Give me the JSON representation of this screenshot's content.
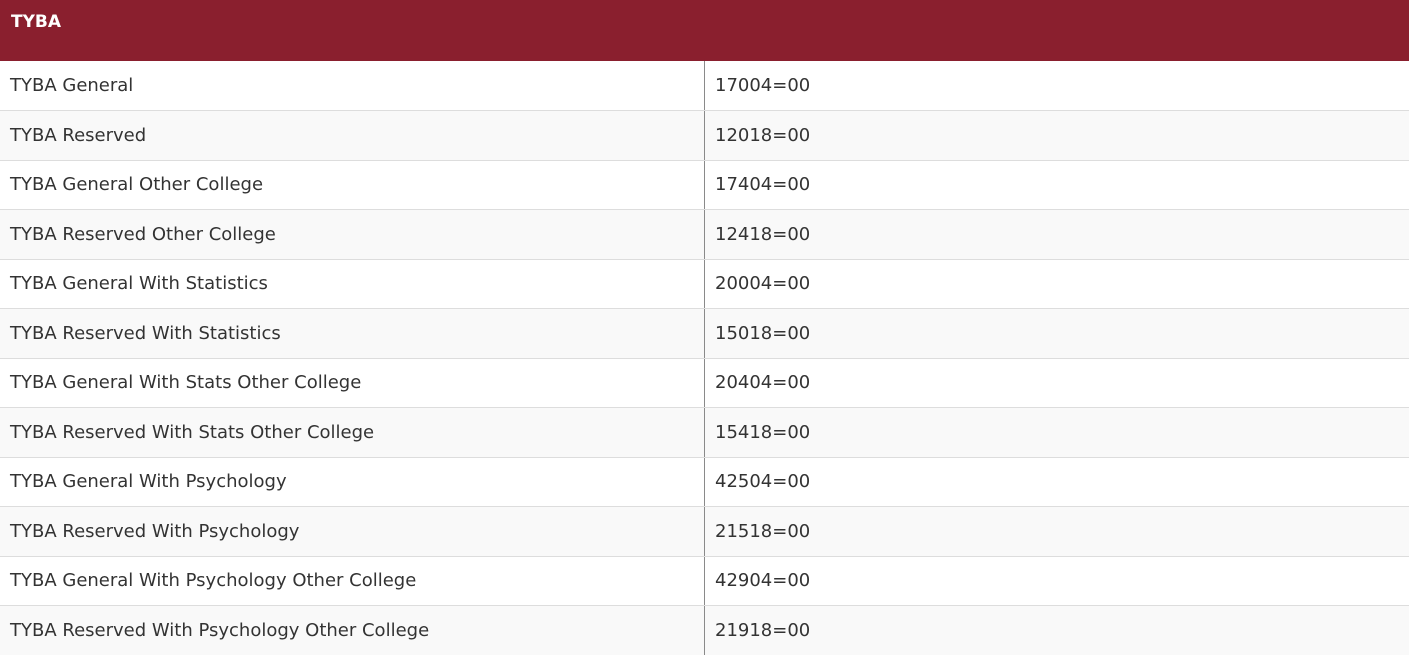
{
  "table": {
    "title": "TYBA",
    "rows": [
      {
        "name": "TYBA General",
        "amount": "17004=00"
      },
      {
        "name": "TYBA Reserved",
        "amount": "12018=00"
      },
      {
        "name": "TYBA General Other College",
        "amount": "17404=00"
      },
      {
        "name": "TYBA Reserved Other College",
        "amount": "12418=00"
      },
      {
        "name": "TYBA General With Statistics",
        "amount": "20004=00"
      },
      {
        "name": "TYBA Reserved With Statistics",
        "amount": "15018=00"
      },
      {
        "name": "TYBA General With Stats Other College",
        "amount": "20404=00"
      },
      {
        "name": "TYBA Reserved With Stats Other College",
        "amount": "15418=00"
      },
      {
        "name": "TYBA General With Psychology",
        "amount": "42504=00"
      },
      {
        "name": "TYBA Reserved With Psychology",
        "amount": "21518=00"
      },
      {
        "name": "TYBA General With Psychology Other College",
        "amount": "42904=00"
      },
      {
        "name": "TYBA Reserved With Psychology Other College",
        "amount": "21918=00"
      }
    ]
  },
  "colors": {
    "header_background": "#8a1f2e",
    "header_text": "#ffffff",
    "row_alt_background": "#f9f9f9"
  }
}
